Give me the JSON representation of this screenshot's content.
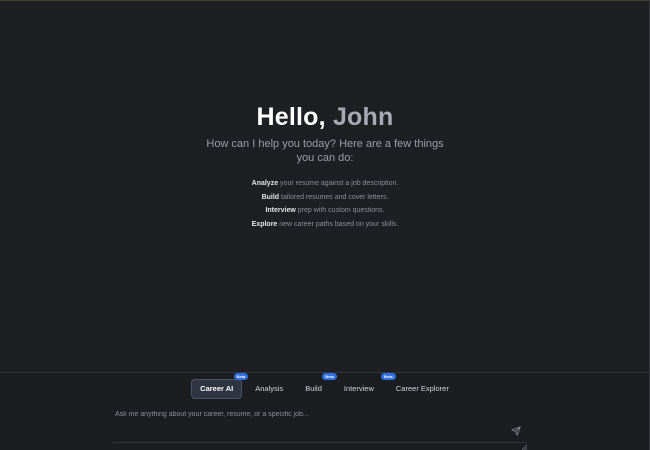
{
  "hero": {
    "greeting_prefix": "Hello, ",
    "user_name": "John",
    "subtitle": "How can I help you today? Here are a few things you can do:",
    "capabilities": [
      {
        "verb": "Analyze",
        "text": " your resume against a job description."
      },
      {
        "verb": "Build",
        "text": " tailored resumes and cover letters."
      },
      {
        "verb": "Interview",
        "text": " prep with custom questions."
      },
      {
        "verb": "Explore",
        "text": " new career paths based on your skills."
      }
    ]
  },
  "composer": {
    "tabs": [
      {
        "label": "Career AI",
        "active": true,
        "badge": "Beta"
      },
      {
        "label": "Analysis",
        "active": false,
        "badge": ""
      },
      {
        "label": "Build",
        "active": false,
        "badge": "Beta"
      },
      {
        "label": "Interview",
        "active": false,
        "badge": ""
      },
      {
        "label": "Career Explorer",
        "active": false,
        "badge": "Beta"
      }
    ],
    "input_placeholder": "Ask me anything about your career, resume, or a specific job...",
    "input_value": "",
    "send_icon": "send-icon"
  },
  "colors": {
    "background": "#1e1f23",
    "accent": "#2f6fe0",
    "active_tab_bg": "#2f3441"
  }
}
